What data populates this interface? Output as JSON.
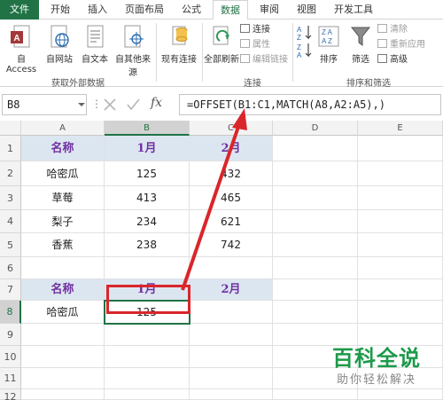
{
  "ribbon_tabs": [
    "文件",
    "开始",
    "插入",
    "页面布局",
    "公式",
    "数据",
    "审阅",
    "视图",
    "开发工具"
  ],
  "active_tab": "数据",
  "get_external": {
    "access": "自 Access",
    "web": "自网站",
    "text": "自文本",
    "other": "自其他来源",
    "label": "获取外部数据"
  },
  "existing": "现有连接",
  "refresh_all": "全部刷新",
  "connections": {
    "connect": "连接",
    "properties": "属性",
    "edit_links": "编辑链接",
    "label": "连接"
  },
  "sort": {
    "sort": "排序",
    "filter": "筛选",
    "clear": "清除",
    "reapply": "重新应用",
    "advanced": "高级",
    "label": "排序和筛选"
  },
  "name_box": "B8",
  "formula": "=OFFSET(B1:C1,MATCH(A8,A2:A5),)",
  "fx_label": "fx",
  "columns": [
    "A",
    "B",
    "C",
    "D",
    "E"
  ],
  "rows": [
    "1",
    "2",
    "3",
    "4",
    "5",
    "6",
    "7",
    "8",
    "9",
    "10",
    "11",
    "12"
  ],
  "table1": {
    "header": [
      "名称",
      "1月",
      "2月"
    ],
    "data": [
      [
        "哈密瓜",
        "125",
        "432"
      ],
      [
        "草莓",
        "413",
        "465"
      ],
      [
        "梨子",
        "234",
        "621"
      ],
      [
        "香蕉",
        "238",
        "742"
      ]
    ]
  },
  "table2": {
    "header": [
      "名称",
      "1月",
      "2月"
    ],
    "row": [
      "哈密瓜",
      "125",
      ""
    ]
  },
  "watermark": {
    "title": "百科全说",
    "subtitle": "助你轻松解决"
  },
  "colors": {
    "accent": "#217346",
    "header_fill": "#dce6f1",
    "header_text": "#7030a0",
    "arrow": "#d9262b",
    "watermark": "#1c9a4a"
  }
}
